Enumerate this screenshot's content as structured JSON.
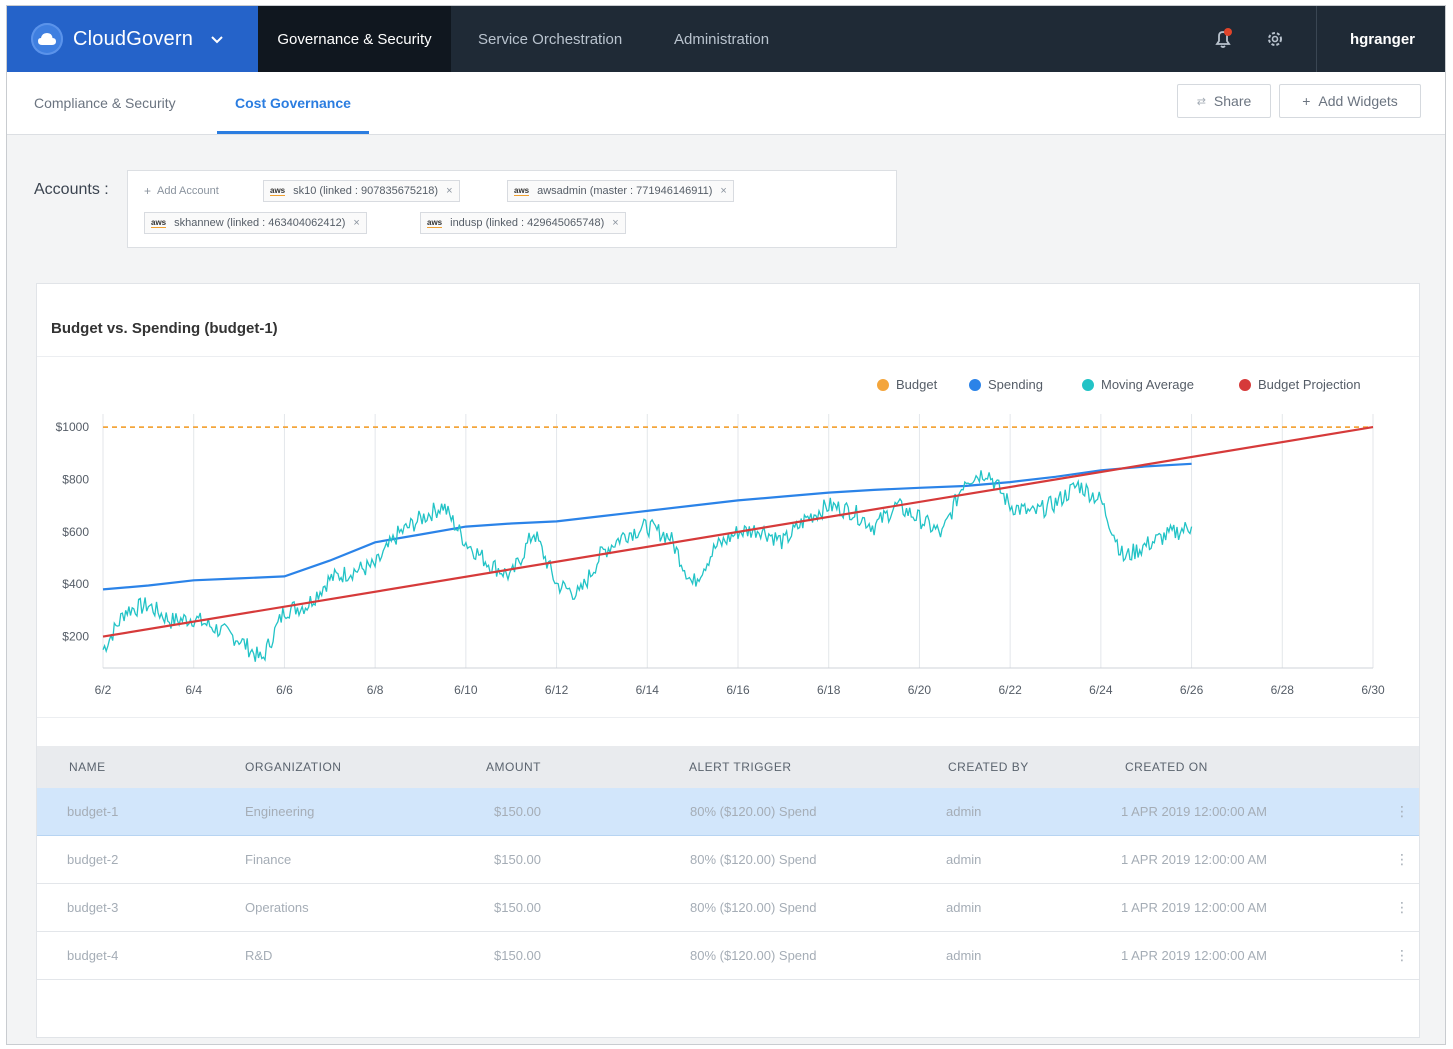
{
  "brand": {
    "name": "CloudGovern"
  },
  "topnav": {
    "items": [
      {
        "label": "Governance & Security",
        "active": true
      },
      {
        "label": "Service Orchestration",
        "active": false
      },
      {
        "label": "Administration",
        "active": false
      }
    ],
    "user": "hgranger",
    "icons": [
      "bell-icon",
      "gear-icon",
      "chevron-down-icon"
    ],
    "notification_dot_color": "#e0442a"
  },
  "subnav": {
    "tabs": [
      {
        "label": "Compliance & Security",
        "active": false
      },
      {
        "label": "Cost Governance",
        "active": true
      }
    ],
    "share_label": "Share",
    "add_widgets_label": "Add Widgets"
  },
  "accounts": {
    "label": "Accounts :",
    "add_label": "Add Account",
    "chips": [
      {
        "provider": "aws",
        "text": "sk10 (linked : 907835675218)"
      },
      {
        "provider": "aws",
        "text": "awsadmin (master : 771946146911)"
      },
      {
        "provider": "aws",
        "text": "skhannew (linked : 463404062412)"
      },
      {
        "provider": "aws",
        "text": "indusp (linked : 429645065748)"
      }
    ]
  },
  "card": {
    "title": "Budget vs. Spending (budget-1)"
  },
  "chart_data": {
    "type": "line",
    "title": "Budget vs. Spending (budget-1)",
    "xlabel": "",
    "ylabel": "",
    "x_ticks": [
      "6/2",
      "6/4",
      "6/6",
      "6/8",
      "6/10",
      "6/12",
      "6/14",
      "6/16",
      "6/18",
      "6/20",
      "6/22",
      "6/24",
      "6/26",
      "6/28",
      "6/30"
    ],
    "y_ticks": [
      "$200",
      "$400",
      "$600",
      "$800",
      "$1000"
    ],
    "xlim": [
      2,
      30
    ],
    "ylim": [
      80,
      1050
    ],
    "grid": true,
    "legend_position": "top-right",
    "series": [
      {
        "name": "Budget",
        "color": "#f4a53b",
        "style": "dashed",
        "points": [
          [
            2,
            1000
          ],
          [
            30,
            1000
          ]
        ]
      },
      {
        "name": "Spending",
        "color": "#2b83e8",
        "points": [
          [
            2,
            380
          ],
          [
            3,
            395
          ],
          [
            4,
            415
          ],
          [
            5,
            422
          ],
          [
            6,
            430
          ],
          [
            7,
            490
          ],
          [
            8,
            560
          ],
          [
            9,
            590
          ],
          [
            10,
            620
          ],
          [
            11,
            632
          ],
          [
            12,
            640
          ],
          [
            13,
            660
          ],
          [
            14,
            680
          ],
          [
            15,
            700
          ],
          [
            16,
            720
          ],
          [
            17,
            735
          ],
          [
            18,
            750
          ],
          [
            19,
            760
          ],
          [
            20,
            768
          ],
          [
            21,
            775
          ],
          [
            22,
            790
          ],
          [
            23,
            810
          ],
          [
            24,
            835
          ],
          [
            25,
            850
          ],
          [
            26,
            860
          ]
        ]
      },
      {
        "name": "Moving Average",
        "color": "#22c3c6",
        "points": [
          [
            2,
            150
          ],
          [
            2.5,
            300
          ],
          [
            3,
            320
          ],
          [
            3.5,
            260
          ],
          [
            4,
            270
          ],
          [
            4.5,
            230
          ],
          [
            5,
            190
          ],
          [
            5.5,
            110
          ],
          [
            6,
            300
          ],
          [
            6.5,
            320
          ],
          [
            7,
            420
          ],
          [
            7.5,
            450
          ],
          [
            8,
            470
          ],
          [
            8.5,
            590
          ],
          [
            9,
            650
          ],
          [
            9.5,
            700
          ],
          [
            10,
            560
          ],
          [
            10.5,
            480
          ],
          [
            11,
            430
          ],
          [
            11.5,
            600
          ],
          [
            12,
            400
          ],
          [
            12.5,
            360
          ],
          [
            13,
            520
          ],
          [
            13.5,
            590
          ],
          [
            14,
            620
          ],
          [
            14.5,
            580
          ],
          [
            15,
            400
          ],
          [
            15.5,
            540
          ],
          [
            16,
            600
          ],
          [
            16.5,
            610
          ],
          [
            17,
            560
          ],
          [
            17.5,
            650
          ],
          [
            18,
            700
          ],
          [
            18.5,
            680
          ],
          [
            19,
            620
          ],
          [
            19.5,
            700
          ],
          [
            20,
            650
          ],
          [
            20.5,
            590
          ],
          [
            21,
            800
          ],
          [
            21.5,
            830
          ],
          [
            22,
            700
          ],
          [
            22.5,
            670
          ],
          [
            23,
            710
          ],
          [
            23.5,
            780
          ],
          [
            24,
            720
          ],
          [
            24.5,
            500
          ],
          [
            25,
            550
          ],
          [
            25.5,
            590
          ],
          [
            26,
            620
          ]
        ]
      },
      {
        "name": "Budget Projection",
        "color": "#d63a3a",
        "points": [
          [
            2,
            200
          ],
          [
            30,
            1000
          ]
        ]
      }
    ]
  },
  "table": {
    "headers": [
      "NAME",
      "ORGANIZATION",
      "AMOUNT",
      "ALERT TRIGGER",
      "CREATED BY",
      "CREATED ON"
    ],
    "rows": [
      {
        "name": "budget-1",
        "org": "Engineering",
        "amount": "$150.00",
        "alert": "80% ($120.00) Spend",
        "by": "admin",
        "on": "1 APR 2019 12:00:00 AM"
      },
      {
        "name": "budget-2",
        "org": "Finance",
        "amount": "$150.00",
        "alert": "80% ($120.00) Spend",
        "by": "admin",
        "on": "1 APR 2019 12:00:00 AM"
      },
      {
        "name": "budget-3",
        "org": "Operations",
        "amount": "$150.00",
        "alert": "80% ($120.00) Spend",
        "by": "admin",
        "on": "1 APR 2019 12:00:00 AM"
      },
      {
        "name": "budget-4",
        "org": "R&D",
        "amount": "$150.00",
        "alert": "80% ($120.00) Spend",
        "by": "admin",
        "on": "1 APR 2019 12:00:00 AM"
      }
    ],
    "kebab": "⋮"
  }
}
